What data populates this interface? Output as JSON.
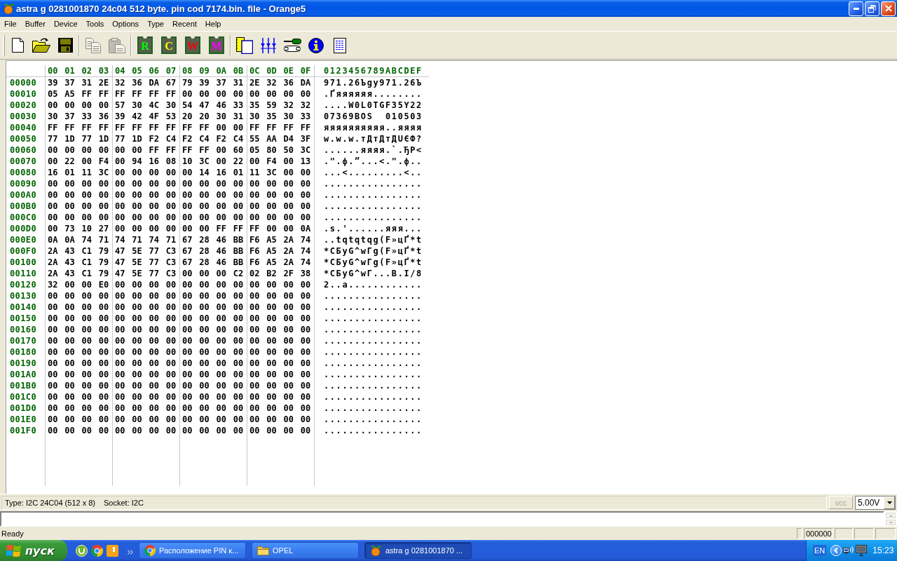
{
  "window": {
    "title": "astra g 0281001870 24c04 512 byte. pin cod 7174.bin. file - Orange5"
  },
  "menu": [
    "File",
    "Buffer",
    "Device",
    "Tools",
    "Options",
    "Type",
    "Recent",
    "Help"
  ],
  "toolbar": [
    {
      "buttons": [
        {
          "kind": "new",
          "disabled": false
        },
        {
          "kind": "open",
          "disabled": false
        },
        {
          "kind": "save",
          "disabled": false
        }
      ]
    },
    {
      "buttons": [
        {
          "kind": "copy",
          "disabled": true
        },
        {
          "kind": "paste",
          "disabled": true
        }
      ]
    },
    {
      "buttons": [
        {
          "kind": "chip",
          "label": "R",
          "color": "#00ff00",
          "disabled": false
        },
        {
          "kind": "chip",
          "label": "C",
          "color": "#ffff00",
          "disabled": false
        },
        {
          "kind": "chip",
          "label": "W",
          "color": "#ff0000",
          "disabled": false
        },
        {
          "kind": "chip",
          "label": "M",
          "color": "#ff00ff",
          "disabled": false
        }
      ]
    },
    {
      "buttons": [
        {
          "kind": "device",
          "disabled": false
        },
        {
          "kind": "settings",
          "disabled": false
        },
        {
          "kind": "tools",
          "disabled": false
        },
        {
          "kind": "info",
          "disabled": false
        },
        {
          "kind": "log",
          "disabled": false
        }
      ]
    }
  ],
  "hex_view": {
    "column_headers": [
      "00 01 02 03",
      "04 05 06 07",
      "08 09 0A 0B",
      "0C 0D 0E 0F"
    ],
    "ascii_header": "0123456789ABCDEF",
    "rows": [
      {
        "address": "00000",
        "bytes": [
          "39 37 31 2E",
          "32 36 DA 67",
          "79 39 37 31",
          "2E 32 36 DA"
        ],
        "ascii": "971.26Ъgy971.26Ъ"
      },
      {
        "address": "00010",
        "bytes": [
          "05 A5 FF FF",
          "FF FF FF FF",
          "00 00 00 00",
          "00 00 00 00"
        ],
        "ascii": ".Ґяяяяяя........"
      },
      {
        "address": "00020",
        "bytes": [
          "00 00 00 00",
          "57 30 4C 30",
          "54 47 46 33",
          "35 59 32 32"
        ],
        "ascii": "....W0L0TGF35Y22"
      },
      {
        "address": "00030",
        "bytes": [
          "30 37 33 36",
          "39 42 4F 53",
          "20 20 30 31",
          "30 35 30 33"
        ],
        "ascii": "07369BOS  010503"
      },
      {
        "address": "00040",
        "bytes": [
          "FF FF FF FF",
          "FF FF FF FF",
          "FF FF 00 00",
          "FF FF FF FF"
        ],
        "ascii": "яяяяяяяяяя..яяяя"
      },
      {
        "address": "00050",
        "bytes": [
          "77 1D 77 1D",
          "77 1D F2 C4",
          "F2 C4 F2 C4",
          "55 AA D4 3F"
        ],
        "ascii": "w.w.w.тДтДтДUЄФ?"
      },
      {
        "address": "00060",
        "bytes": [
          "00 00 00 00",
          "00 00 FF FF",
          "FF FF 00 60",
          "05 80 50 3C"
        ],
        "ascii": "......яяяя.`.ЂP<"
      },
      {
        "address": "00070",
        "bytes": [
          "00 22 00 F4",
          "00 94 16 08",
          "10 3C 00 22",
          "00 F4 00 13"
        ],
        "ascii": ".\".ф.”...<.\".ф.."
      },
      {
        "address": "00080",
        "bytes": [
          "16 01 11 3C",
          "00 00 00 00",
          "00 14 16 01",
          "11 3C 00 00"
        ],
        "ascii": "...<.........<.."
      },
      {
        "address": "00090",
        "bytes": [
          "00 00 00 00",
          "00 00 00 00",
          "00 00 00 00",
          "00 00 00 00"
        ],
        "ascii": "................"
      },
      {
        "address": "000A0",
        "bytes": [
          "00 00 00 00",
          "00 00 00 00",
          "00 00 00 00",
          "00 00 00 00"
        ],
        "ascii": "................"
      },
      {
        "address": "000B0",
        "bytes": [
          "00 00 00 00",
          "00 00 00 00",
          "00 00 00 00",
          "00 00 00 00"
        ],
        "ascii": "................"
      },
      {
        "address": "000C0",
        "bytes": [
          "00 00 00 00",
          "00 00 00 00",
          "00 00 00 00",
          "00 00 00 00"
        ],
        "ascii": "................"
      },
      {
        "address": "000D0",
        "bytes": [
          "00 73 10 27",
          "00 00 00 00",
          "00 00 FF FF",
          "FF 00 00 0A"
        ],
        "ascii": ".s.'......яяя..."
      },
      {
        "address": "000E0",
        "bytes": [
          "0A 0A 74 71",
          "74 71 74 71",
          "67 28 46 BB",
          "F6 A5 2A 74"
        ],
        "ascii": "..tqtqtqg(F»цҐ*t"
      },
      {
        "address": "000F0",
        "bytes": [
          "2A 43 C1 79",
          "47 5E 77 C3",
          "67 28 46 BB",
          "F6 A5 2A 74"
        ],
        "ascii": "*CБyG^wГg(F»цҐ*t"
      },
      {
        "address": "00100",
        "bytes": [
          "2A 43 C1 79",
          "47 5E 77 C3",
          "67 28 46 BB",
          "F6 A5 2A 74"
        ],
        "ascii": "*CБyG^wГg(F»цҐ*t"
      },
      {
        "address": "00110",
        "bytes": [
          "2A 43 C1 79",
          "47 5E 77 C3",
          "00 00 00 C2",
          "02 B2 2F 38"
        ],
        "ascii": "*CБyG^wГ...В.І/8"
      },
      {
        "address": "00120",
        "bytes": [
          "32 00 00 E0",
          "00 00 00 00",
          "00 00 00 00",
          "00 00 00 00"
        ],
        "ascii": "2..а............"
      },
      {
        "address": "00130",
        "bytes": [
          "00 00 00 00",
          "00 00 00 00",
          "00 00 00 00",
          "00 00 00 00"
        ],
        "ascii": "................"
      },
      {
        "address": "00140",
        "bytes": [
          "00 00 00 00",
          "00 00 00 00",
          "00 00 00 00",
          "00 00 00 00"
        ],
        "ascii": "................"
      },
      {
        "address": "00150",
        "bytes": [
          "00 00 00 00",
          "00 00 00 00",
          "00 00 00 00",
          "00 00 00 00"
        ],
        "ascii": "................"
      },
      {
        "address": "00160",
        "bytes": [
          "00 00 00 00",
          "00 00 00 00",
          "00 00 00 00",
          "00 00 00 00"
        ],
        "ascii": "................"
      },
      {
        "address": "00170",
        "bytes": [
          "00 00 00 00",
          "00 00 00 00",
          "00 00 00 00",
          "00 00 00 00"
        ],
        "ascii": "................"
      },
      {
        "address": "00180",
        "bytes": [
          "00 00 00 00",
          "00 00 00 00",
          "00 00 00 00",
          "00 00 00 00"
        ],
        "ascii": "................"
      },
      {
        "address": "00190",
        "bytes": [
          "00 00 00 00",
          "00 00 00 00",
          "00 00 00 00",
          "00 00 00 00"
        ],
        "ascii": "................"
      },
      {
        "address": "001A0",
        "bytes": [
          "00 00 00 00",
          "00 00 00 00",
          "00 00 00 00",
          "00 00 00 00"
        ],
        "ascii": "................"
      },
      {
        "address": "001B0",
        "bytes": [
          "00 00 00 00",
          "00 00 00 00",
          "00 00 00 00",
          "00 00 00 00"
        ],
        "ascii": "................"
      },
      {
        "address": "001C0",
        "bytes": [
          "00 00 00 00",
          "00 00 00 00",
          "00 00 00 00",
          "00 00 00 00"
        ],
        "ascii": "................"
      },
      {
        "address": "001D0",
        "bytes": [
          "00 00 00 00",
          "00 00 00 00",
          "00 00 00 00",
          "00 00 00 00"
        ],
        "ascii": "................"
      },
      {
        "address": "001E0",
        "bytes": [
          "00 00 00 00",
          "00 00 00 00",
          "00 00 00 00",
          "00 00 00 00"
        ],
        "ascii": "................"
      },
      {
        "address": "001F0",
        "bytes": [
          "00 00 00 00",
          "00 00 00 00",
          "00 00 00 00",
          "00 00 00 00"
        ],
        "ascii": "................"
      }
    ]
  },
  "device_bar": {
    "type_info": "Type: I2C 24C04 (512 x 8)",
    "socket_info": "Socket: I2C",
    "vcc_button": {
      "label": "vcc",
      "disabled": true
    },
    "voltage": "5.00V"
  },
  "status_bar": {
    "message": "Ready",
    "address": "000000"
  },
  "taskbar": {
    "start_label": "пуск",
    "tasks": [
      {
        "kind": "browser",
        "label": "Расположение PIN к...",
        "selected": false
      },
      {
        "kind": "folder",
        "label": "OPEL",
        "selected": false
      },
      {
        "kind": "app",
        "label": "astra g 0281001870 ...",
        "selected": true
      }
    ],
    "tray": {
      "language": "EN",
      "clock": "15:23"
    }
  }
}
